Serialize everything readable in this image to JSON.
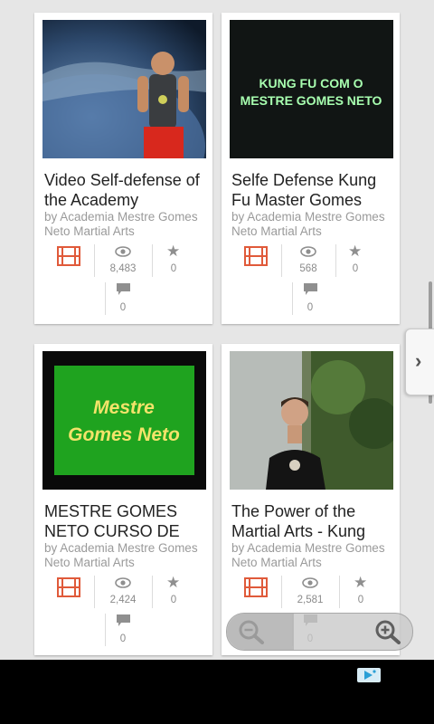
{
  "videos": [
    {
      "title": "Video Self-defense of the Academy",
      "author": "by Academia Mestre Gomes Neto Martial Arts",
      "views": "8,483",
      "stars": "0",
      "comments": "0"
    },
    {
      "title": "Selfe Defense Kung Fu Master Gomes",
      "author": "by Academia Mestre Gomes Neto Martial Arts",
      "views": "568",
      "stars": "0",
      "comments": "0",
      "thumb_text_line1": "KUNG FU COM O",
      "thumb_text_line2": "MESTRE GOMES NETO"
    },
    {
      "title": "MESTRE GOMES NETO CURSO DE",
      "author": "by Academia Mestre Gomes Neto Martial Arts",
      "views": "2,424",
      "stars": "0",
      "comments": "0",
      "thumb_text_line1": "Mestre",
      "thumb_text_line2": "Gomes Neto"
    },
    {
      "title": "The Power of the Martial Arts - Kung",
      "author": "by Academia Mestre Gomes Neto Martial Arts",
      "views": "2,581",
      "stars": "0",
      "comments": "0"
    }
  ],
  "colors": {
    "film_icon": "#e05a3a",
    "icon_gray": "#8f8f8f",
    "thumb2_glow": "#a8ffb0",
    "thumb3_green": "#1fa31f",
    "thumb3_text": "#f3e36a"
  },
  "icons": {
    "film": "film-icon",
    "views": "eye-icon",
    "stars": "star-icon",
    "comments": "comment-icon",
    "side_tab": "chevron-right-icon",
    "zoom_out": "zoom-out-icon",
    "zoom_in": "zoom-in-icon",
    "ad": "ad-choices-icon"
  },
  "side_tab_glyph": "›"
}
